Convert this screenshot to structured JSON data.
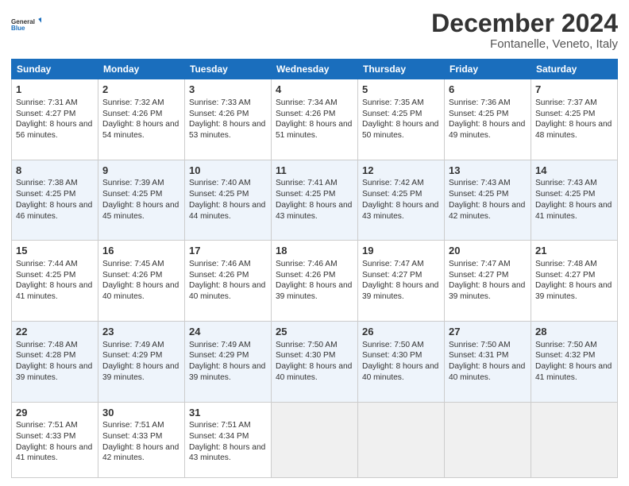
{
  "logo": {
    "line1": "General",
    "line2": "Blue"
  },
  "title": "December 2024",
  "subtitle": "Fontanelle, Veneto, Italy",
  "weekdays": [
    "Sunday",
    "Monday",
    "Tuesday",
    "Wednesday",
    "Thursday",
    "Friday",
    "Saturday"
  ],
  "weeks": [
    [
      {
        "day": 1,
        "sunrise": "7:31 AM",
        "sunset": "4:27 PM",
        "daylight": "8 hours and 56 minutes."
      },
      {
        "day": 2,
        "sunrise": "7:32 AM",
        "sunset": "4:26 PM",
        "daylight": "8 hours and 54 minutes."
      },
      {
        "day": 3,
        "sunrise": "7:33 AM",
        "sunset": "4:26 PM",
        "daylight": "8 hours and 53 minutes."
      },
      {
        "day": 4,
        "sunrise": "7:34 AM",
        "sunset": "4:26 PM",
        "daylight": "8 hours and 51 minutes."
      },
      {
        "day": 5,
        "sunrise": "7:35 AM",
        "sunset": "4:25 PM",
        "daylight": "8 hours and 50 minutes."
      },
      {
        "day": 6,
        "sunrise": "7:36 AM",
        "sunset": "4:25 PM",
        "daylight": "8 hours and 49 minutes."
      },
      {
        "day": 7,
        "sunrise": "7:37 AM",
        "sunset": "4:25 PM",
        "daylight": "8 hours and 48 minutes."
      }
    ],
    [
      {
        "day": 8,
        "sunrise": "7:38 AM",
        "sunset": "4:25 PM",
        "daylight": "8 hours and 46 minutes."
      },
      {
        "day": 9,
        "sunrise": "7:39 AM",
        "sunset": "4:25 PM",
        "daylight": "8 hours and 45 minutes."
      },
      {
        "day": 10,
        "sunrise": "7:40 AM",
        "sunset": "4:25 PM",
        "daylight": "8 hours and 44 minutes."
      },
      {
        "day": 11,
        "sunrise": "7:41 AM",
        "sunset": "4:25 PM",
        "daylight": "8 hours and 43 minutes."
      },
      {
        "day": 12,
        "sunrise": "7:42 AM",
        "sunset": "4:25 PM",
        "daylight": "8 hours and 43 minutes."
      },
      {
        "day": 13,
        "sunrise": "7:43 AM",
        "sunset": "4:25 PM",
        "daylight": "8 hours and 42 minutes."
      },
      {
        "day": 14,
        "sunrise": "7:43 AM",
        "sunset": "4:25 PM",
        "daylight": "8 hours and 41 minutes."
      }
    ],
    [
      {
        "day": 15,
        "sunrise": "7:44 AM",
        "sunset": "4:25 PM",
        "daylight": "8 hours and 41 minutes."
      },
      {
        "day": 16,
        "sunrise": "7:45 AM",
        "sunset": "4:26 PM",
        "daylight": "8 hours and 40 minutes."
      },
      {
        "day": 17,
        "sunrise": "7:46 AM",
        "sunset": "4:26 PM",
        "daylight": "8 hours and 40 minutes."
      },
      {
        "day": 18,
        "sunrise": "7:46 AM",
        "sunset": "4:26 PM",
        "daylight": "8 hours and 39 minutes."
      },
      {
        "day": 19,
        "sunrise": "7:47 AM",
        "sunset": "4:27 PM",
        "daylight": "8 hours and 39 minutes."
      },
      {
        "day": 20,
        "sunrise": "7:47 AM",
        "sunset": "4:27 PM",
        "daylight": "8 hours and 39 minutes."
      },
      {
        "day": 21,
        "sunrise": "7:48 AM",
        "sunset": "4:27 PM",
        "daylight": "8 hours and 39 minutes."
      }
    ],
    [
      {
        "day": 22,
        "sunrise": "7:48 AM",
        "sunset": "4:28 PM",
        "daylight": "8 hours and 39 minutes."
      },
      {
        "day": 23,
        "sunrise": "7:49 AM",
        "sunset": "4:29 PM",
        "daylight": "8 hours and 39 minutes."
      },
      {
        "day": 24,
        "sunrise": "7:49 AM",
        "sunset": "4:29 PM",
        "daylight": "8 hours and 39 minutes."
      },
      {
        "day": 25,
        "sunrise": "7:50 AM",
        "sunset": "4:30 PM",
        "daylight": "8 hours and 40 minutes."
      },
      {
        "day": 26,
        "sunrise": "7:50 AM",
        "sunset": "4:30 PM",
        "daylight": "8 hours and 40 minutes."
      },
      {
        "day": 27,
        "sunrise": "7:50 AM",
        "sunset": "4:31 PM",
        "daylight": "8 hours and 40 minutes."
      },
      {
        "day": 28,
        "sunrise": "7:50 AM",
        "sunset": "4:32 PM",
        "daylight": "8 hours and 41 minutes."
      }
    ],
    [
      {
        "day": 29,
        "sunrise": "7:51 AM",
        "sunset": "4:33 PM",
        "daylight": "8 hours and 41 minutes."
      },
      {
        "day": 30,
        "sunrise": "7:51 AM",
        "sunset": "4:33 PM",
        "daylight": "8 hours and 42 minutes."
      },
      {
        "day": 31,
        "sunrise": "7:51 AM",
        "sunset": "4:34 PM",
        "daylight": "8 hours and 43 minutes."
      },
      null,
      null,
      null,
      null
    ]
  ],
  "labels": {
    "sunrise": "Sunrise:",
    "sunset": "Sunset:",
    "daylight": "Daylight:"
  }
}
